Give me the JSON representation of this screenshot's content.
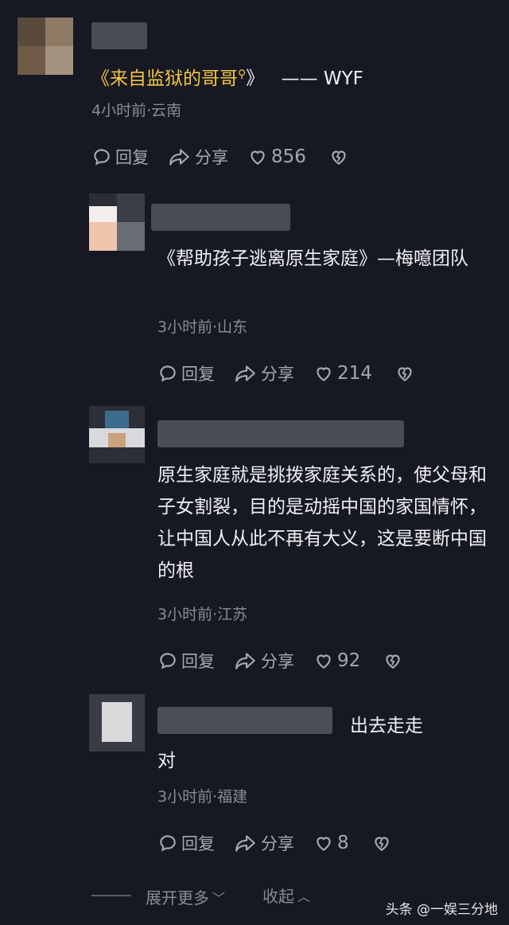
{
  "comments": [
    {
      "link_text": "《来自监狱的哥哥",
      "link_close": "》",
      "suffix": "—— WYF",
      "meta": "4小时前·云南",
      "reply": "回复",
      "share": "分享",
      "likes": "856"
    },
    {
      "text": "《帮助孩子逃离原生家庭》—梅噫团队",
      "meta": "3小时前·山东",
      "reply": "回复",
      "share": "分享",
      "likes": "214"
    },
    {
      "text": "原生家庭就是挑拨家庭关系的，使父母和子女割裂，目的是动摇中国的家国情怀，让中国人从此不再有大义，这是要断中国的根",
      "meta": "3小时前·江苏",
      "reply": "回复",
      "share": "分享",
      "likes": "92"
    },
    {
      "reply_to": "出去走走",
      "text": "对",
      "meta": "3小时前·福建",
      "reply": "回复",
      "share": "分享",
      "likes": "8"
    }
  ],
  "footer": {
    "expand": "展开更多",
    "collapse": "收起"
  },
  "watermark": "头条 @一娱三分地"
}
